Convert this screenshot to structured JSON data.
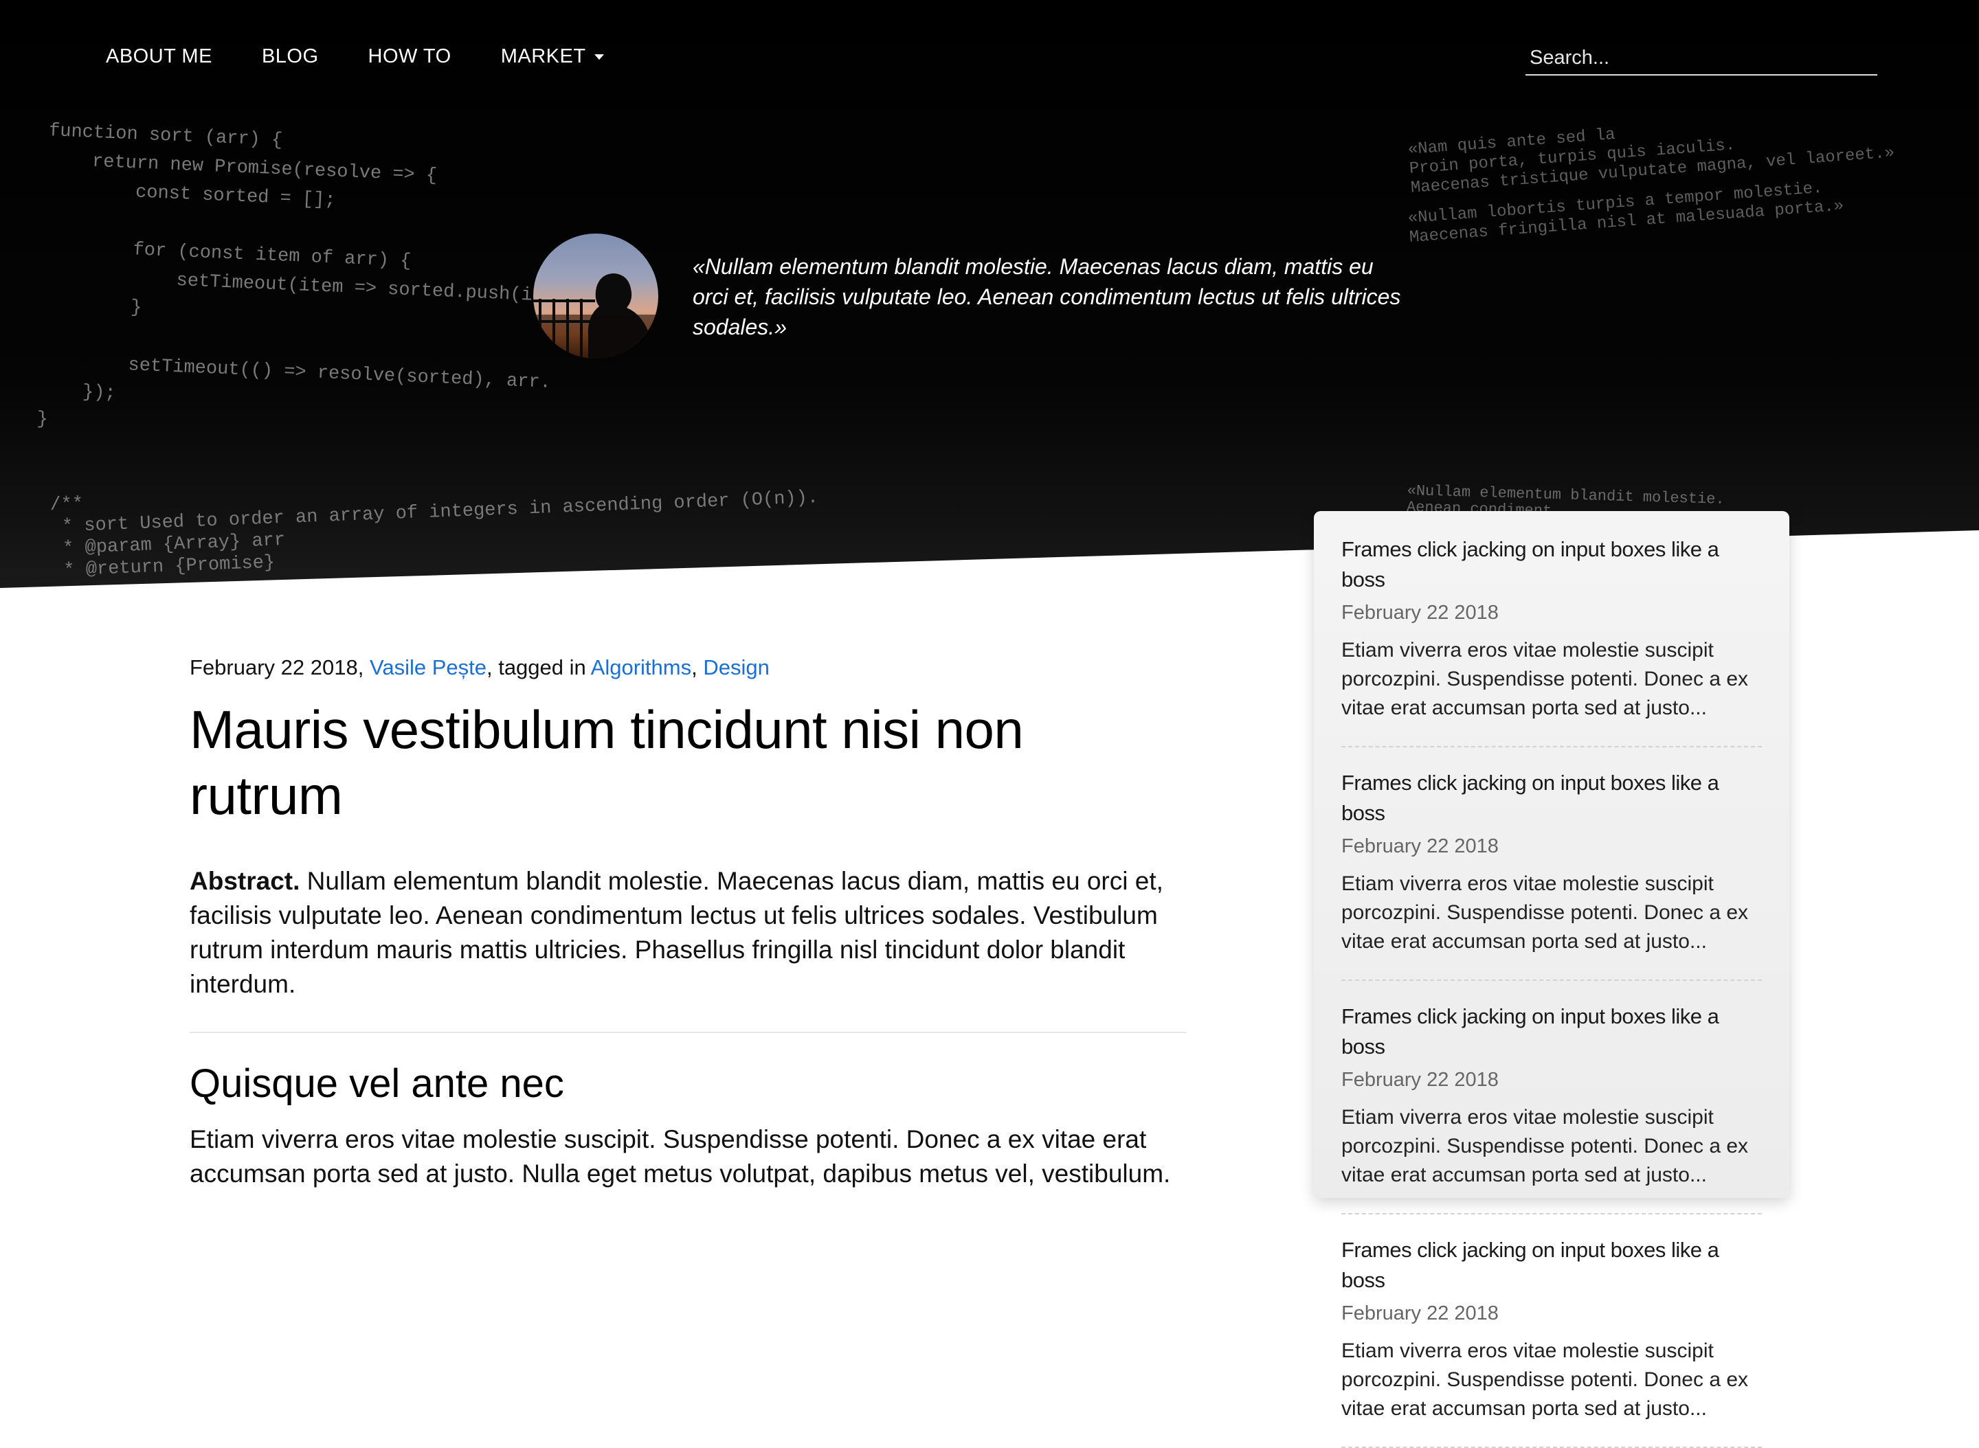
{
  "nav": {
    "items": [
      {
        "label": "ABOUT ME"
      },
      {
        "label": "BLOG"
      },
      {
        "label": "HOW TO"
      },
      {
        "label": "MARKET"
      }
    ],
    "search_placeholder": "Search..."
  },
  "hero": {
    "quote": "«Nullam elementum blandit molestie. Maecenas lacus diam, mattis eu orci et, facilisis vulputate leo. Aenean condimentum lectus ut felis ultrices sodales.»",
    "code_top_left": "function sort (arr) {\n    return new Promise(resolve => {\n        const sorted = [];\n\n        for (const item of arr) {\n            setTimeout(item => sorted.push(item\n        }\n\n        setTimeout(() => resolve(sorted), arr.\n    });\n}",
    "code_bottom_left": "/**\n * sort Used to order an array of integers in ascending order (O(n)).\n * @param {Array} arr\n * @return {Promise}",
    "code_top_right_1": "«Nam quis ante sed la\nProin porta, turpis quis iaculis.\nMaecenas tristique vulputate magna, vel laoreet.»",
    "code_top_right_2": "«Nullam lobortis turpis a tempor molestie.\nMaecenas fringilla nisl at malesuada porta.»",
    "code_mid_right": "«Nullam elementum blandit molestie.\nAenean condiment"
  },
  "article": {
    "date": "February 22 2018",
    "author": "Vasile Pește",
    "tagged_in": "tagged in",
    "tags": [
      "Algorithms",
      "Design"
    ],
    "title": "Mauris vestibulum tincidunt nisi non rutrum",
    "abstract_label": "Abstract.",
    "abstract_text": "Nullam elementum blandit molestie. Maecenas lacus diam, mattis eu orci et, facilisis vulputate leo. Aenean condimentum lectus ut felis ultrices sodales. Vestibulum rutrum interdum mauris mattis ultricies. Phasellus fringilla nisl tincidunt dolor blandit interdum.",
    "section_heading": "Quisque vel ante nec",
    "section_text": "Etiam viverra eros vitae molestie suscipit. Suspendisse potenti. Donec a ex vitae erat accumsan porta sed at justo. Nulla eget metus volutpat, dapibus metus vel, vestibulum."
  },
  "sidebar": {
    "items": [
      {
        "title": "Frames click jacking on input boxes like a boss",
        "date": "February 22 2018",
        "excerpt": "Etiam viverra eros vitae molestie suscipit porcozpini. Suspendisse potenti. Donec a ex vitae erat accumsan porta sed at justo..."
      },
      {
        "title": "Frames click jacking on input boxes like a boss",
        "date": "February 22 2018",
        "excerpt": "Etiam viverra eros vitae molestie suscipit porcozpini. Suspendisse potenti. Donec a ex vitae erat accumsan porta sed at justo..."
      },
      {
        "title": "Frames click jacking on input boxes like a boss",
        "date": "February 22 2018",
        "excerpt": "Etiam viverra eros vitae molestie suscipit porcozpini. Suspendisse potenti. Donec a ex vitae erat accumsan porta sed at justo..."
      },
      {
        "title": "Frames click jacking on input boxes like a boss",
        "date": "February 22 2018",
        "excerpt": "Etiam viverra eros vitae molestie suscipit porcozpini. Suspendisse potenti. Donec a ex vitae erat accumsan porta sed at justo..."
      }
    ]
  }
}
